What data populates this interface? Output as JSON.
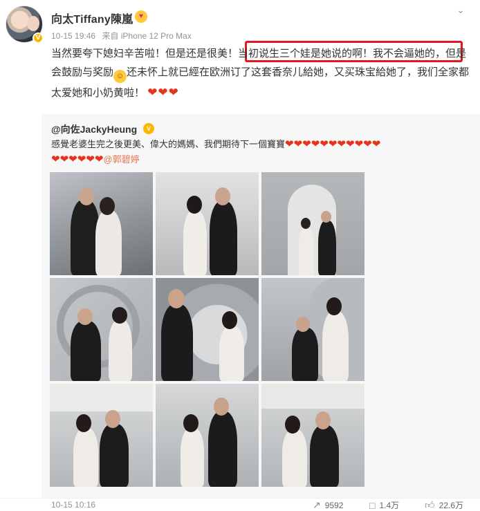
{
  "post": {
    "author": "向太Tiffany陳嵐",
    "time": "10-15 19:46",
    "source_label": "来自",
    "source": "iPhone 12 Pro Max",
    "text_part1": "当然要夸下媳妇辛苦啦！但是还是很美！",
    "text_highlight": "当初说生三个娃是她说的啊！我不会逼她的，",
    "text_part2": "但是会鼓励与奖励",
    "text_part3": "还未怀上就已經在欧洲订了这套香奈儿給她，又买珠宝給她了，我们全家都太爱她和小奶黄啦！",
    "hearts_end": "❤❤❤"
  },
  "repost": {
    "user": "@向佐JackyHeung",
    "text": "感覺老婆生完之後更美、偉大的媽媽、我們期待下一個寶寶",
    "hearts_line1": "❤❤❤❤❤❤❤❤❤❤❤",
    "hearts_line2": "❤❤❤❤❤❤",
    "mention": "@郭碧婷",
    "photo_count": 9
  },
  "footer": {
    "time": "10-15 10:16",
    "shares": "9592",
    "comments": "1.4万",
    "likes": "22.6万"
  },
  "icons": [
    "chevron-down-icon",
    "verified-badge-icon",
    "laugh-emoji-icon",
    "share-icon",
    "comment-icon",
    "like-icon"
  ],
  "colors": {
    "highlight_border": "#e4161b",
    "heart": "#e8331c",
    "mention": "#eb7350",
    "repost_bg": "#f7f7f7",
    "meta": "#939393"
  }
}
